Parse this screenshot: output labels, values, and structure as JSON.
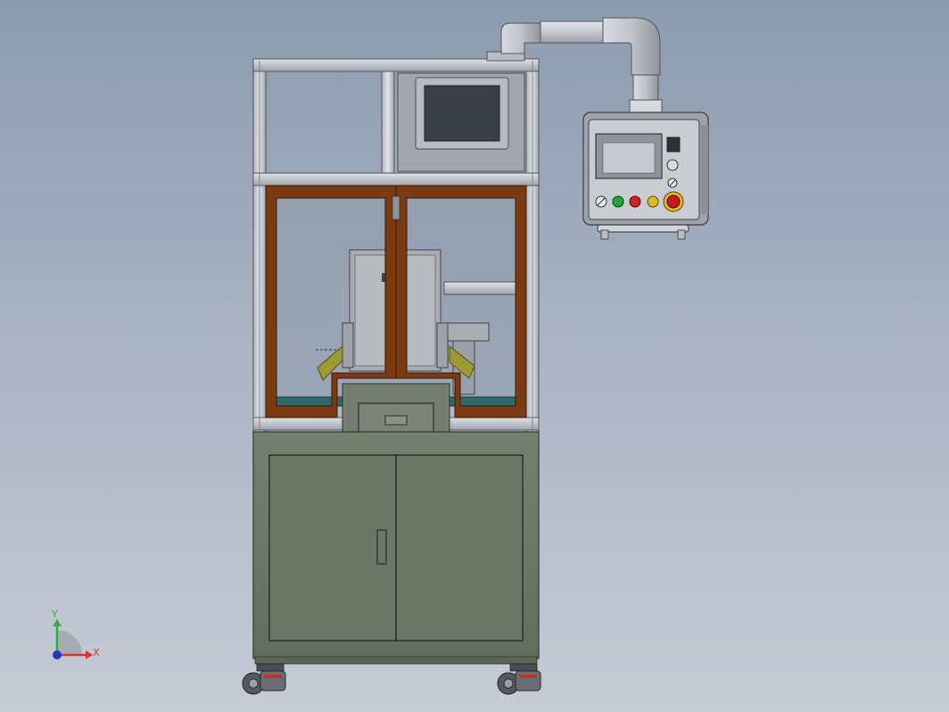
{
  "triad": {
    "x_label": "X",
    "y_label": "Y",
    "x_color": "#e03030",
    "y_color": "#2fae3a",
    "z_color": "#2233cc"
  },
  "colors": {
    "background_top": "#8c9bb0",
    "background_bottom": "#c6ccd6",
    "aluminum_frame": "#c9ced6",
    "door_frame": "#7a3b13",
    "cabinet": "#6b7564",
    "screen": "#3a3f48",
    "start_button": "#1fa83a",
    "stop_button": "#d02020",
    "reset_button": "#e0b820",
    "emergency_stop": "#c81818"
  }
}
